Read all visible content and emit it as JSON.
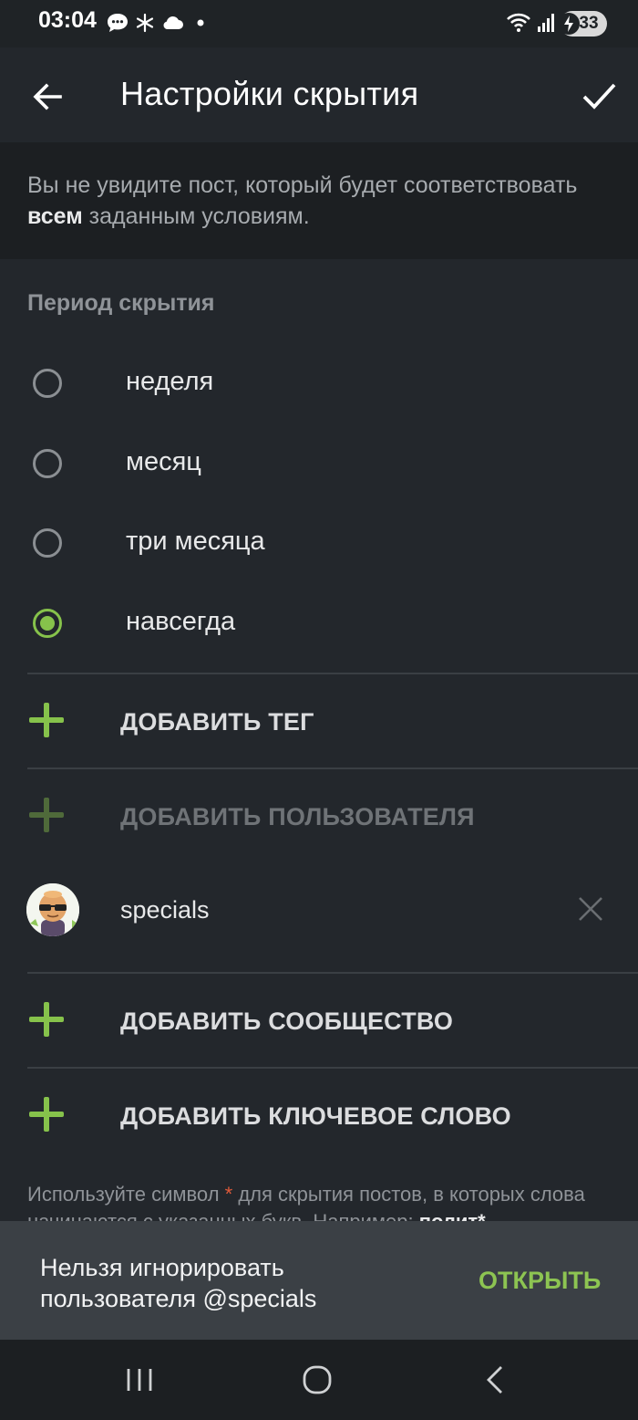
{
  "status_bar": {
    "time": "03:04",
    "battery": "33"
  },
  "app_bar": {
    "title": "Настройки скрытия"
  },
  "info": {
    "text_before": "Вы не увидите пост, который будет соответствовать ",
    "text_bold": "всем",
    "text_after": " заданным условиям."
  },
  "period": {
    "label": "Период скрытия",
    "options": [
      "неделя",
      "месяц",
      "три месяца",
      "навсегда"
    ],
    "selected": "навсегда"
  },
  "actions": {
    "add_tag": "ДОБАВИТЬ ТЕГ",
    "add_user": "ДОБАВИТЬ ПОЛЬЗОВАТЕЛЯ",
    "add_community": "ДОБАВИТЬ СООБЩЕСТВО",
    "add_keyword": "ДОБАВИТЬ КЛЮЧЕВОЕ СЛОВО"
  },
  "users": [
    {
      "name": "specials"
    }
  ],
  "hint": {
    "part1": "Используйте символ ",
    "star": "*",
    "part2": " для скрытия постов, в которых слова начинаются с указанных букв. Например: ",
    "example": "полит*"
  },
  "snackbar": {
    "message": "Нельзя игнорировать пользователя @specials",
    "action": "ОТКРЫТЬ"
  },
  "colors": {
    "accent": "#86c24b",
    "background": "#23272c",
    "snackbar": "#3b4045"
  }
}
